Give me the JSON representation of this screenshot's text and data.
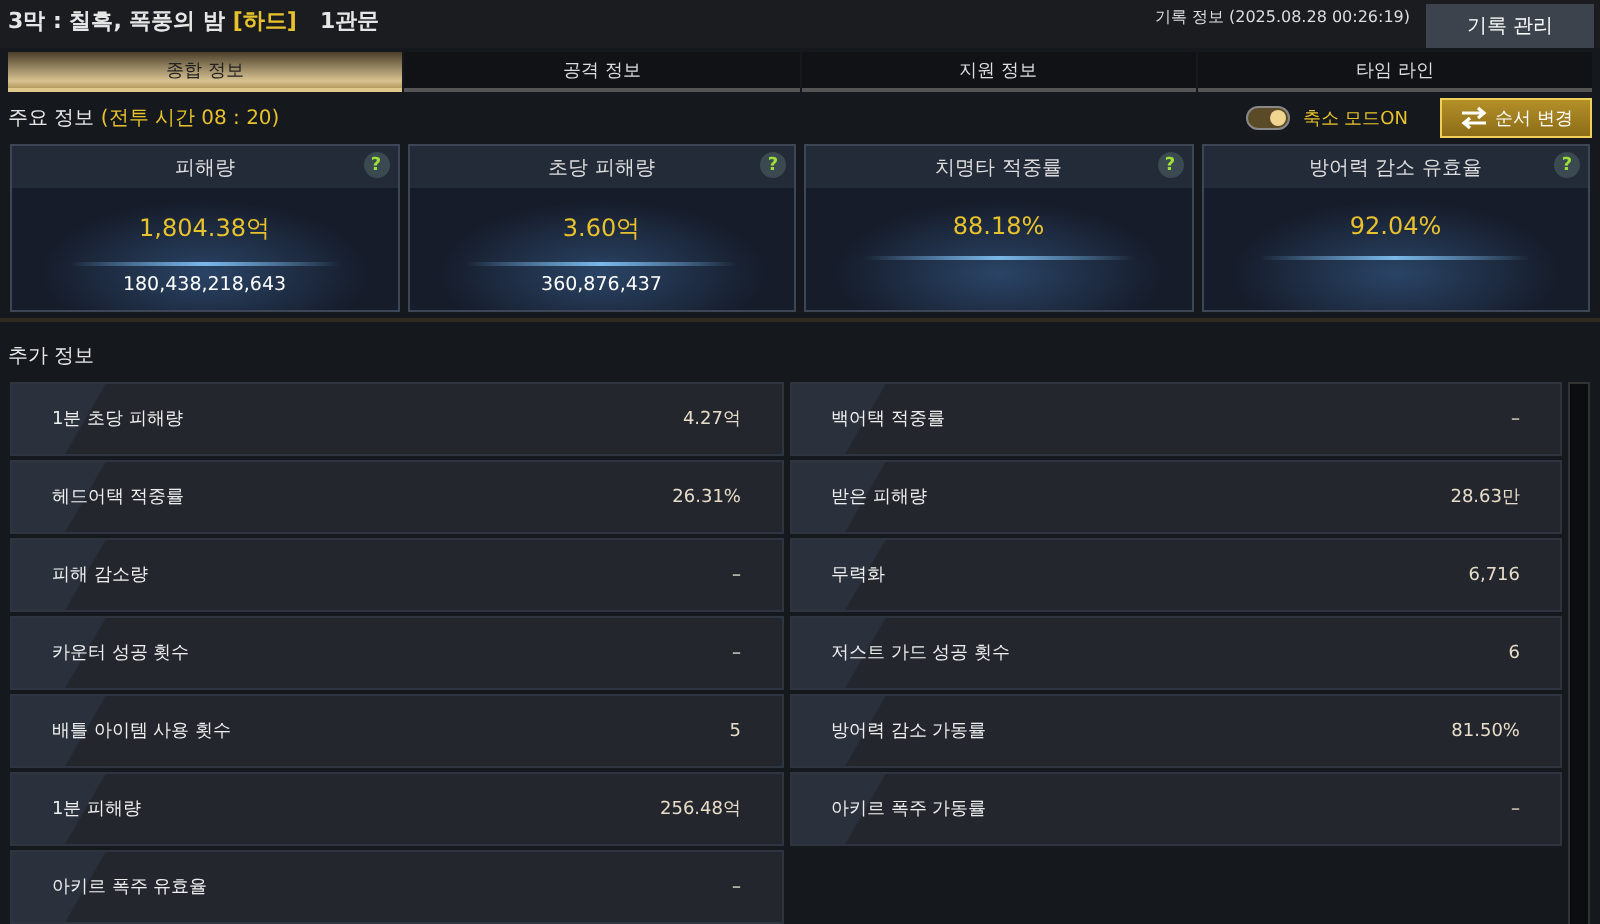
{
  "title": {
    "text": "3막 : 칠흑, 폭풍의 밤",
    "difficulty": "[하드]",
    "stage": "1관문"
  },
  "record_info": "기록 정보 (2025.08.28 00:26:19)",
  "record_button": "기록 관리",
  "tabs": [
    {
      "label": "종합 정보",
      "selected": true
    },
    {
      "label": "공격 정보",
      "selected": false
    },
    {
      "label": "지원 정보",
      "selected": false
    },
    {
      "label": "타임 라인",
      "selected": false
    }
  ],
  "main_info": {
    "label": "주요 정보",
    "battle_time": "(전투 시간 08 : 20)"
  },
  "compact_toggle": {
    "label": "축소 모드ON",
    "on": true
  },
  "sort_button": "순서 변경",
  "cards": [
    {
      "title": "피해량",
      "value": "1,804.38억",
      "detail": "180,438,218,643",
      "help": "?"
    },
    {
      "title": "초당 피해량",
      "value": "3.60억",
      "detail": "360,876,437",
      "help": "?"
    },
    {
      "title": "치명타 적중률",
      "value": "88.18%",
      "help": "?"
    },
    {
      "title": "방어력 감소 유효율",
      "value": "92.04%",
      "help": "?"
    }
  ],
  "extra_info": {
    "label": "추가 정보"
  },
  "stats_left": [
    {
      "name": "1분 초당 피해량",
      "value": "4.27억"
    },
    {
      "name": "헤드어택 적중률",
      "value": "26.31%"
    },
    {
      "name": "피해 감소량",
      "value": "–"
    },
    {
      "name": "카운터 성공 횟수",
      "value": "–"
    },
    {
      "name": "배틀 아이템 사용 횟수",
      "value": "5"
    },
    {
      "name": "1분 피해량",
      "value": "256.48억"
    },
    {
      "name": "아키르 폭주 유효율",
      "value": "–"
    }
  ],
  "stats_right": [
    {
      "name": "백어택 적중률",
      "value": "–"
    },
    {
      "name": "받은 피해량",
      "value": "28.63만"
    },
    {
      "name": "무력화",
      "value": "6,716"
    },
    {
      "name": "저스트 가드 성공 횟수",
      "value": "6"
    },
    {
      "name": "방어력 감소 가동률",
      "value": "81.50%"
    },
    {
      "name": "아키르 폭주 가동률",
      "value": "–"
    }
  ]
}
